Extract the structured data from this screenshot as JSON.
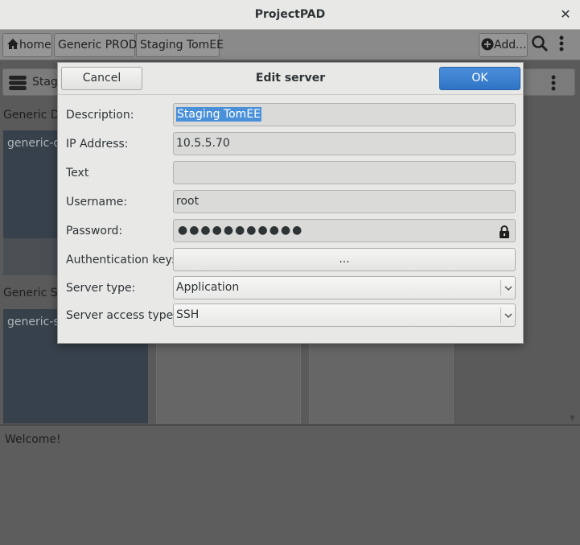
{
  "window": {
    "title": "ProjectPAD",
    "close_glyph": "✕"
  },
  "toolbar": {
    "tabs": [
      {
        "label": "home",
        "icon": "home-icon"
      },
      {
        "label": "Generic PROD"
      },
      {
        "label": "Staging TomEE"
      }
    ],
    "add_label": "Add...",
    "search_icon": "search-icon",
    "more_icon": "more-vertical-icon"
  },
  "background": {
    "header_label": "Stag",
    "section1_label": "Generic DI",
    "card1_label": "generic-d",
    "section2_label": "Generic ST",
    "card2_label": "generic-s",
    "log_text": "Welcome!"
  },
  "dialog": {
    "title": "Edit server",
    "cancel_label": "Cancel",
    "ok_label": "OK",
    "fields": {
      "description": {
        "label": "Description:",
        "value": "Staging TomEE"
      },
      "ip_address": {
        "label": "IP Address:",
        "value": "10.5.5.70"
      },
      "text": {
        "label": "Text",
        "value": ""
      },
      "username": {
        "label": "Username:",
        "value": "root"
      },
      "password": {
        "label": "Password:",
        "value": "●●●●●●●●●●●"
      },
      "auth_key": {
        "label": "Authentication key:",
        "button": "..."
      },
      "server_type": {
        "label": "Server type:",
        "value": "Application"
      },
      "server_access_type": {
        "label": "Server access type:",
        "value": "SSH"
      }
    }
  },
  "colors": {
    "accent": "#3a7fd0",
    "overlay": "#5a5a5a",
    "dialog_bg": "#e8e8e7"
  }
}
